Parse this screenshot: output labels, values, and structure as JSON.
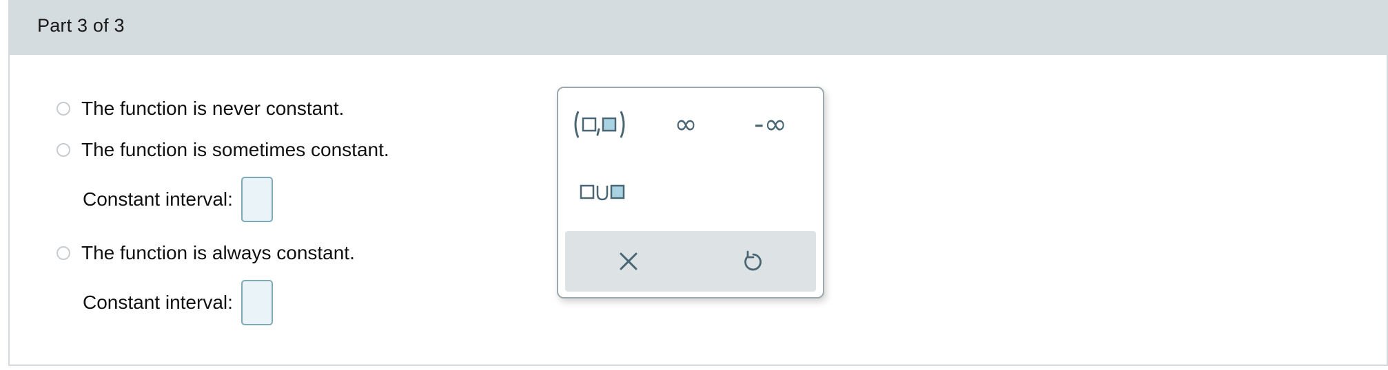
{
  "part": {
    "title": "Part 3 of 3"
  },
  "options": [
    {
      "label": "The function is never constant."
    },
    {
      "label": "The function is sometimes constant."
    },
    {
      "label": "The function is always constant."
    }
  ],
  "constant_interval": {
    "label": "Constant interval:"
  },
  "palette": {
    "buttons": [
      {
        "icon": "open-interval-icon"
      },
      {
        "icon": "infinity-icon",
        "text": "∞"
      },
      {
        "icon": "negative-infinity-icon",
        "text": "-∞"
      },
      {
        "icon": "union-icon"
      }
    ],
    "footer": [
      {
        "icon": "clear-x-icon"
      },
      {
        "icon": "undo-icon"
      }
    ]
  },
  "colors": {
    "header_bg": "#d5dcdf",
    "answer_box_border": "#7eaab8",
    "answer_box_fill": "#eaf3f8",
    "palette_icon": "#4a6673",
    "palette_footer_bg": "#dde2e5"
  }
}
